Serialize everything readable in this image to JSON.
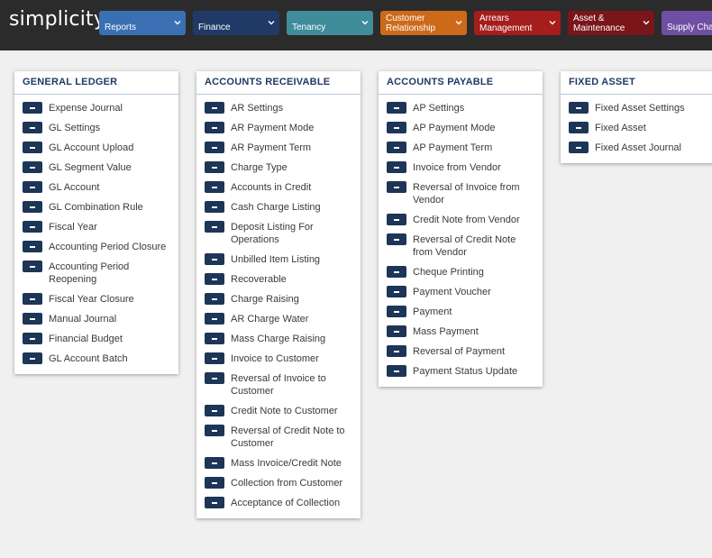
{
  "app": {
    "logo": "simplicity"
  },
  "nav": [
    {
      "label": "Reports",
      "color": "#3a6fb3"
    },
    {
      "label": "Finance",
      "color": "#1f3a66"
    },
    {
      "label": "Tenancy",
      "color": "#3f8c9b"
    },
    {
      "label": "Customer\nRelationship",
      "color": "#cc6a1a"
    },
    {
      "label": "Arrears\nManagement",
      "color": "#a51d1d"
    },
    {
      "label": "Asset &\nMaintenance",
      "color": "#7a1519"
    },
    {
      "label": "Supply Chai",
      "color": "#6e4fa3"
    }
  ],
  "menus": [
    {
      "title": "GENERAL LEDGER",
      "items": [
        "Expense Journal",
        "GL Settings",
        "GL Account Upload",
        "GL Segment Value",
        "GL Account",
        "GL Combination Rule",
        "Fiscal Year",
        "Accounting Period Closure",
        "Accounting Period Reopening",
        "Fiscal Year Closure",
        "Manual Journal",
        "Financial Budget",
        "GL Account Batch"
      ]
    },
    {
      "title": "ACCOUNTS RECEIVABLE",
      "items": [
        "AR Settings",
        "AR Payment Mode",
        "AR Payment Term",
        "Charge Type",
        "Accounts in Credit",
        "Cash Charge Listing",
        "Deposit Listing For Operations",
        "Unbilled Item Listing",
        "Recoverable",
        "Charge Raising",
        "AR Charge Water",
        "Mass Charge Raising",
        "Invoice to Customer",
        "Reversal of Invoice to Customer",
        "Credit Note to Customer",
        "Reversal of Credit Note to Customer",
        "Mass Invoice/Credit Note",
        "Collection from Customer",
        "Acceptance of Collection"
      ]
    },
    {
      "title": "ACCOUNTS PAYABLE",
      "items": [
        "AP Settings",
        "AP Payment Mode",
        "AP Payment Term",
        "Invoice from Vendor",
        "Reversal of Invoice from Vendor",
        "Credit Note from Vendor",
        "Reversal of Credit Note from Vendor",
        "Cheque Printing",
        "Payment Voucher",
        "Payment",
        "Mass Payment",
        "Reversal of Payment",
        "Payment Status Update"
      ]
    },
    {
      "title": "FIXED ASSET",
      "items": [
        "Fixed Asset Settings",
        "Fixed Asset",
        "Fixed Asset Journal"
      ]
    }
  ]
}
